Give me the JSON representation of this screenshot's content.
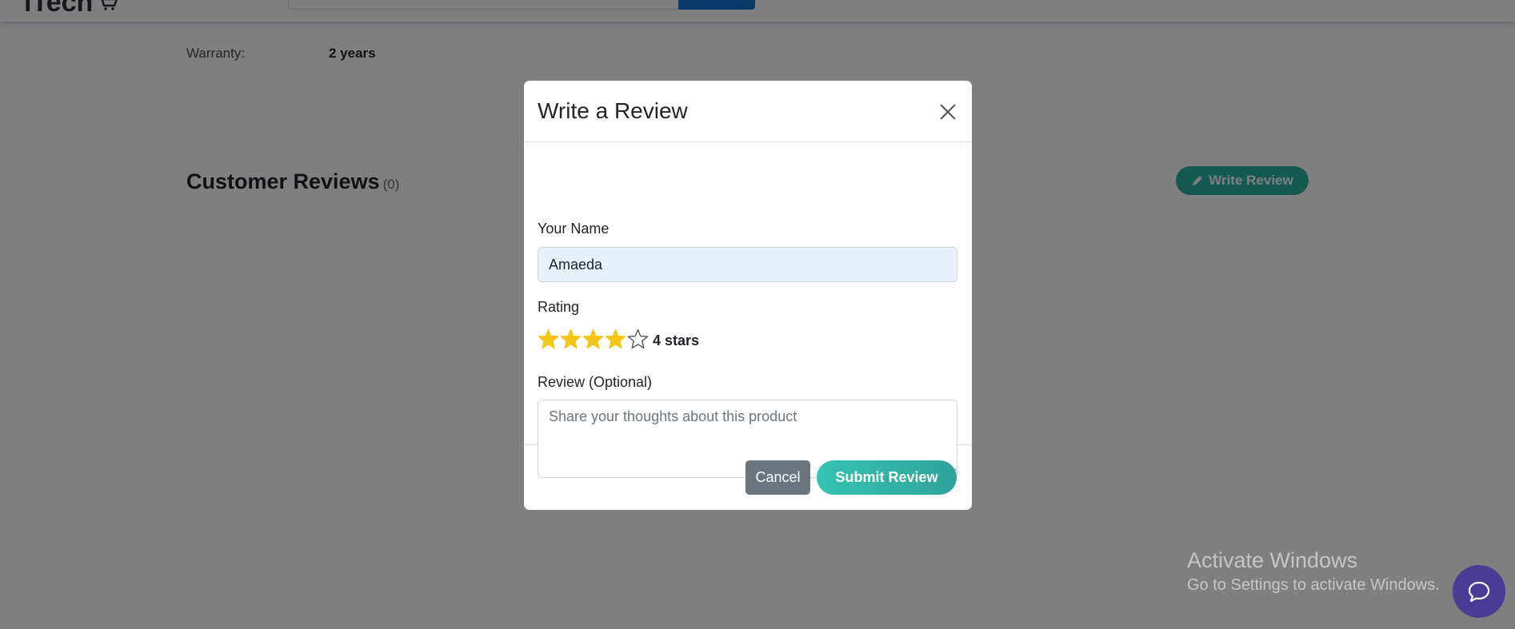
{
  "header": {
    "logo_text": "iTech",
    "cart_icon": "cart-icon"
  },
  "specs": {
    "warranty_label": "Warranty:",
    "warranty_value": "2 years"
  },
  "reviews_section": {
    "title": "Customer Reviews",
    "count": "(0)",
    "write_button_label": "Write Review",
    "write_button_icon": "pencil-icon"
  },
  "modal": {
    "title": "Write a Review",
    "close_icon": "close-icon",
    "name_label": "Your Name",
    "name_value": "Amaeda",
    "rating_label": "Rating",
    "rating_value": 4,
    "rating_max": 5,
    "rating_text": "4 stars",
    "review_label": "Review (Optional)",
    "review_placeholder": "Share your thoughts about this product",
    "cancel_label": "Cancel",
    "submit_label": "Submit Review"
  },
  "windows_watermark": {
    "line1": "Activate Windows",
    "line2": "Go to Settings to activate Windows."
  },
  "chat": {
    "icon": "chat-bubble-icon"
  },
  "colors": {
    "accent": "#2bb5a3",
    "star_fill": "#f5c518",
    "cancel_bg": "#6c757d",
    "chat_bg": "#4a3b95"
  }
}
